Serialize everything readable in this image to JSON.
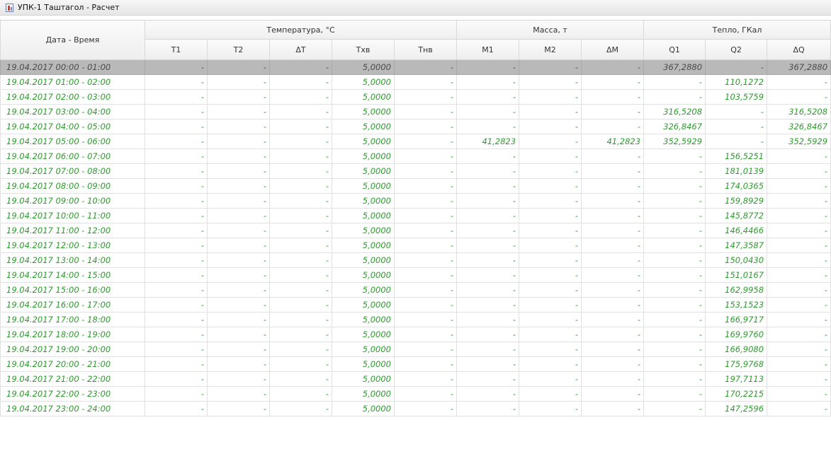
{
  "window": {
    "title": "УПК-1 Таштагол - Расчет"
  },
  "columns": {
    "date": "Дата - Время",
    "group_temp": "Температура, °С",
    "group_mass": "Масса, т",
    "group_heat": "Тепло, ГКал",
    "t1": "T1",
    "t2": "T2",
    "dt": "ΔT",
    "txv": "Tхв",
    "tnv": "Tнв",
    "m1": "M1",
    "m2": "M2",
    "dm": "ΔM",
    "q1": "Q1",
    "q2": "Q2",
    "dq": "ΔQ"
  },
  "rows": [
    {
      "date": "19.04.2017 00:00 - 01:00",
      "t1": "-",
      "t2": "-",
      "dt": "-",
      "txv": "5,0000",
      "tnv": "-",
      "m1": "-",
      "m2": "-",
      "dm": "-",
      "q1": "367,2880",
      "q2": "-",
      "dq": "367,2880"
    },
    {
      "date": "19.04.2017 01:00 - 02:00",
      "t1": "-",
      "t2": "-",
      "dt": "-",
      "txv": "5,0000",
      "tnv": "-",
      "m1": "-",
      "m2": "-",
      "dm": "-",
      "q1": "-",
      "q2": "110,1272",
      "dq": "-"
    },
    {
      "date": "19.04.2017 02:00 - 03:00",
      "t1": "-",
      "t2": "-",
      "dt": "-",
      "txv": "5,0000",
      "tnv": "-",
      "m1": "-",
      "m2": "-",
      "dm": "-",
      "q1": "-",
      "q2": "103,5759",
      "dq": "-"
    },
    {
      "date": "19.04.2017 03:00 - 04:00",
      "t1": "-",
      "t2": "-",
      "dt": "-",
      "txv": "5,0000",
      "tnv": "-",
      "m1": "-",
      "m2": "-",
      "dm": "-",
      "q1": "316,5208",
      "q2": "-",
      "dq": "316,5208"
    },
    {
      "date": "19.04.2017 04:00 - 05:00",
      "t1": "-",
      "t2": "-",
      "dt": "-",
      "txv": "5,0000",
      "tnv": "-",
      "m1": "-",
      "m2": "-",
      "dm": "-",
      "q1": "326,8467",
      "q2": "-",
      "dq": "326,8467"
    },
    {
      "date": "19.04.2017 05:00 - 06:00",
      "t1": "-",
      "t2": "-",
      "dt": "-",
      "txv": "5,0000",
      "tnv": "-",
      "m1": "41,2823",
      "m2": "-",
      "dm": "41,2823",
      "q1": "352,5929",
      "q2": "-",
      "dq": "352,5929"
    },
    {
      "date": "19.04.2017 06:00 - 07:00",
      "t1": "-",
      "t2": "-",
      "dt": "-",
      "txv": "5,0000",
      "tnv": "-",
      "m1": "-",
      "m2": "-",
      "dm": "-",
      "q1": "-",
      "q2": "156,5251",
      "dq": "-"
    },
    {
      "date": "19.04.2017 07:00 - 08:00",
      "t1": "-",
      "t2": "-",
      "dt": "-",
      "txv": "5,0000",
      "tnv": "-",
      "m1": "-",
      "m2": "-",
      "dm": "-",
      "q1": "-",
      "q2": "181,0139",
      "dq": "-"
    },
    {
      "date": "19.04.2017 08:00 - 09:00",
      "t1": "-",
      "t2": "-",
      "dt": "-",
      "txv": "5,0000",
      "tnv": "-",
      "m1": "-",
      "m2": "-",
      "dm": "-",
      "q1": "-",
      "q2": "174,0365",
      "dq": "-"
    },
    {
      "date": "19.04.2017 09:00 - 10:00",
      "t1": "-",
      "t2": "-",
      "dt": "-",
      "txv": "5,0000",
      "tnv": "-",
      "m1": "-",
      "m2": "-",
      "dm": "-",
      "q1": "-",
      "q2": "159,8929",
      "dq": "-"
    },
    {
      "date": "19.04.2017 10:00 - 11:00",
      "t1": "-",
      "t2": "-",
      "dt": "-",
      "txv": "5,0000",
      "tnv": "-",
      "m1": "-",
      "m2": "-",
      "dm": "-",
      "q1": "-",
      "q2": "145,8772",
      "dq": "-"
    },
    {
      "date": "19.04.2017 11:00 - 12:00",
      "t1": "-",
      "t2": "-",
      "dt": "-",
      "txv": "5,0000",
      "tnv": "-",
      "m1": "-",
      "m2": "-",
      "dm": "-",
      "q1": "-",
      "q2": "146,4466",
      "dq": "-"
    },
    {
      "date": "19.04.2017 12:00 - 13:00",
      "t1": "-",
      "t2": "-",
      "dt": "-",
      "txv": "5,0000",
      "tnv": "-",
      "m1": "-",
      "m2": "-",
      "dm": "-",
      "q1": "-",
      "q2": "147,3587",
      "dq": "-"
    },
    {
      "date": "19.04.2017 13:00 - 14:00",
      "t1": "-",
      "t2": "-",
      "dt": "-",
      "txv": "5,0000",
      "tnv": "-",
      "m1": "-",
      "m2": "-",
      "dm": "-",
      "q1": "-",
      "q2": "150,0430",
      "dq": "-"
    },
    {
      "date": "19.04.2017 14:00 - 15:00",
      "t1": "-",
      "t2": "-",
      "dt": "-",
      "txv": "5,0000",
      "tnv": "-",
      "m1": "-",
      "m2": "-",
      "dm": "-",
      "q1": "-",
      "q2": "151,0167",
      "dq": "-"
    },
    {
      "date": "19.04.2017 15:00 - 16:00",
      "t1": "-",
      "t2": "-",
      "dt": "-",
      "txv": "5,0000",
      "tnv": "-",
      "m1": "-",
      "m2": "-",
      "dm": "-",
      "q1": "-",
      "q2": "162,9958",
      "dq": "-"
    },
    {
      "date": "19.04.2017 16:00 - 17:00",
      "t1": "-",
      "t2": "-",
      "dt": "-",
      "txv": "5,0000",
      "tnv": "-",
      "m1": "-",
      "m2": "-",
      "dm": "-",
      "q1": "-",
      "q2": "153,1523",
      "dq": "-"
    },
    {
      "date": "19.04.2017 17:00 - 18:00",
      "t1": "-",
      "t2": "-",
      "dt": "-",
      "txv": "5,0000",
      "tnv": "-",
      "m1": "-",
      "m2": "-",
      "dm": "-",
      "q1": "-",
      "q2": "166,9717",
      "dq": "-"
    },
    {
      "date": "19.04.2017 18:00 - 19:00",
      "t1": "-",
      "t2": "-",
      "dt": "-",
      "txv": "5,0000",
      "tnv": "-",
      "m1": "-",
      "m2": "-",
      "dm": "-",
      "q1": "-",
      "q2": "169,9760",
      "dq": "-"
    },
    {
      "date": "19.04.2017 19:00 - 20:00",
      "t1": "-",
      "t2": "-",
      "dt": "-",
      "txv": "5,0000",
      "tnv": "-",
      "m1": "-",
      "m2": "-",
      "dm": "-",
      "q1": "-",
      "q2": "166,9080",
      "dq": "-"
    },
    {
      "date": "19.04.2017 20:00 - 21:00",
      "t1": "-",
      "t2": "-",
      "dt": "-",
      "txv": "5,0000",
      "tnv": "-",
      "m1": "-",
      "m2": "-",
      "dm": "-",
      "q1": "-",
      "q2": "175,9768",
      "dq": "-"
    },
    {
      "date": "19.04.2017 21:00 - 22:00",
      "t1": "-",
      "t2": "-",
      "dt": "-",
      "txv": "5,0000",
      "tnv": "-",
      "m1": "-",
      "m2": "-",
      "dm": "-",
      "q1": "-",
      "q2": "197,7113",
      "dq": "-"
    },
    {
      "date": "19.04.2017 22:00 - 23:00",
      "t1": "-",
      "t2": "-",
      "dt": "-",
      "txv": "5,0000",
      "tnv": "-",
      "m1": "-",
      "m2": "-",
      "dm": "-",
      "q1": "-",
      "q2": "170,2215",
      "dq": "-"
    },
    {
      "date": "19.04.2017 23:00 - 24:00",
      "t1": "-",
      "t2": "-",
      "dt": "-",
      "txv": "5,0000",
      "tnv": "-",
      "m1": "-",
      "m2": "-",
      "dm": "-",
      "q1": "-",
      "q2": "147,2596",
      "dq": "-"
    }
  ]
}
